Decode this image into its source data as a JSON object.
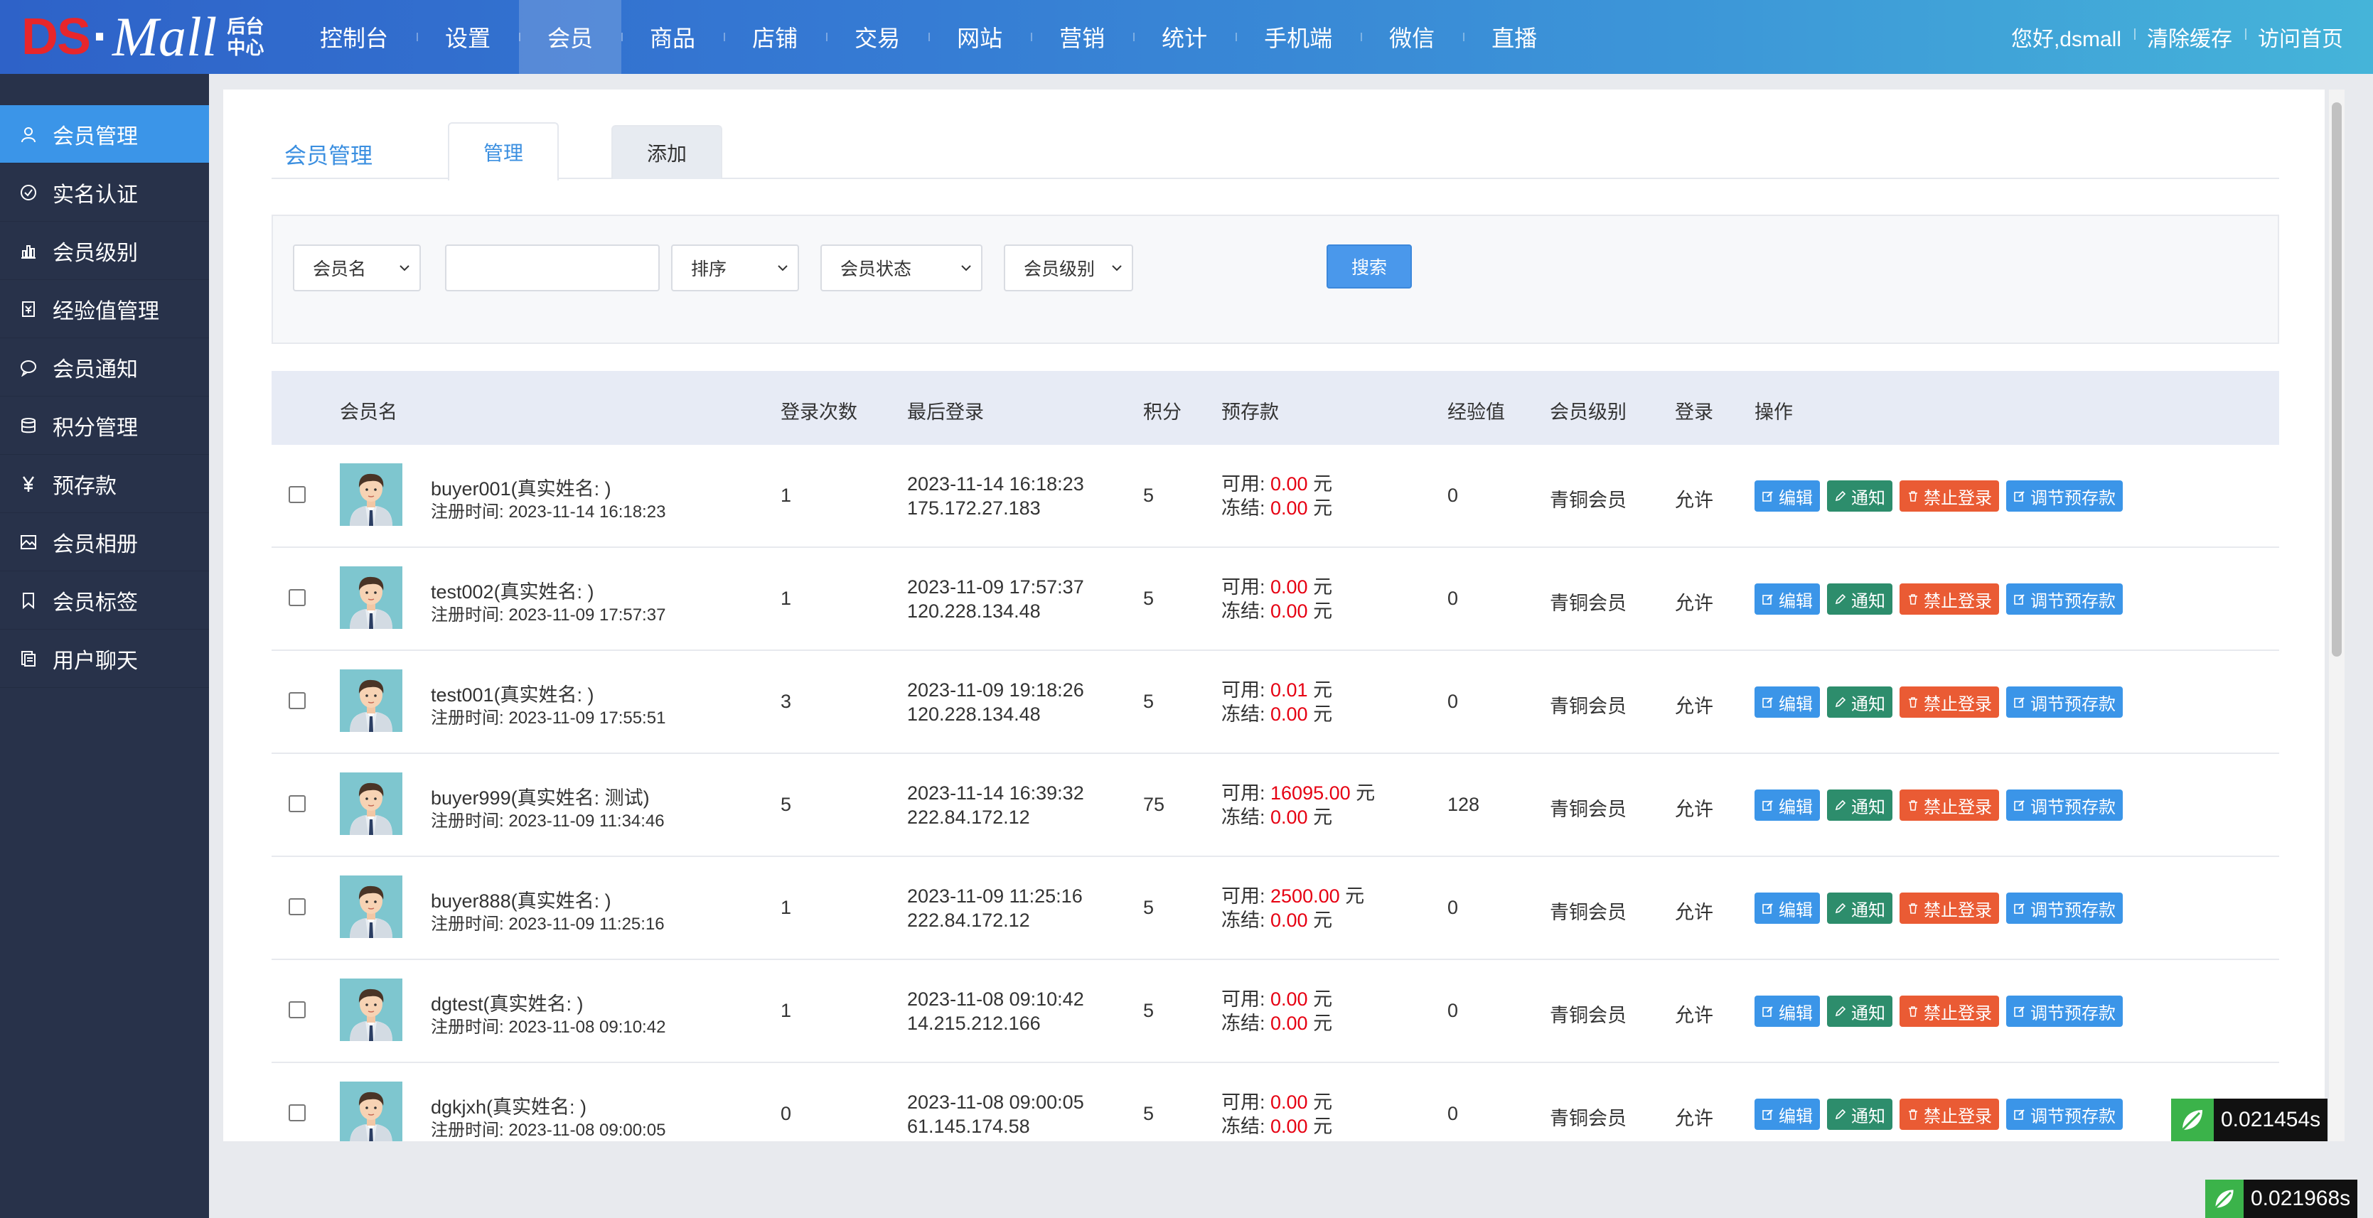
{
  "logo": {
    "ds": "DS",
    "dot": "·",
    "mall": "Mall",
    "sub": "后台中心"
  },
  "nav": [
    "控制台",
    "设置",
    "会员",
    "商品",
    "店铺",
    "交易",
    "网站",
    "营销",
    "统计",
    "手机端",
    "微信",
    "直播"
  ],
  "nav_active": "会员",
  "top_links": {
    "greeting": "您好,dsmall",
    "clear_cache": "清除缓存",
    "visit_home": "访问首页"
  },
  "sidebar": [
    {
      "label": "会员管理",
      "icon": "user-icon"
    },
    {
      "label": "实名认证",
      "icon": "check-circle-icon"
    },
    {
      "label": "会员级别",
      "icon": "bar-chart-icon"
    },
    {
      "label": "经验值管理",
      "icon": "ledger-icon"
    },
    {
      "label": "会员通知",
      "icon": "chat-bubble-icon"
    },
    {
      "label": "积分管理",
      "icon": "database-icon"
    },
    {
      "label": "预存款",
      "icon": "yen-icon"
    },
    {
      "label": "会员相册",
      "icon": "image-icon"
    },
    {
      "label": "会员标签",
      "icon": "bookmark-icon"
    },
    {
      "label": "用户聊天",
      "icon": "copy-icon"
    }
  ],
  "page": {
    "title": "会员管理",
    "tab_manage": "管理",
    "tab_add": "添加"
  },
  "filter": {
    "field_select": "会员名",
    "keyword_value": "",
    "sort_select": "排序",
    "status_select": "会员状态",
    "level_select": "会员级别",
    "search_button": "搜索"
  },
  "table": {
    "headers": {
      "member": "会员名",
      "login_count": "登录次数",
      "last_login": "最后登录",
      "points": "积分",
      "deposit": "预存款",
      "exp": "经验值",
      "level": "会员级别",
      "login": "登录",
      "ops": "操作"
    },
    "labels": {
      "available": "可用: ",
      "frozen": "冻结: ",
      "yuan": " 元",
      "reg_prefix": "注册时间: "
    },
    "op_labels": {
      "edit": "编辑",
      "notify": "通知",
      "ban": "禁止登录",
      "adjust": "调节预存款"
    },
    "rows": [
      {
        "name": "buyer001(真实姓名: )",
        "reg": "2023-11-14 16:18:23",
        "login_count": "1",
        "last_time": "2023-11-14 16:18:23",
        "last_ip": "175.172.27.183",
        "points": "5",
        "available": "0.00",
        "frozen": "0.00",
        "exp": "0",
        "level": "青铜会员",
        "login": "允许"
      },
      {
        "name": "test002(真实姓名: )",
        "reg": "2023-11-09 17:57:37",
        "login_count": "1",
        "last_time": "2023-11-09 17:57:37",
        "last_ip": "120.228.134.48",
        "points": "5",
        "available": "0.00",
        "frozen": "0.00",
        "exp": "0",
        "level": "青铜会员",
        "login": "允许"
      },
      {
        "name": "test001(真实姓名: )",
        "reg": "2023-11-09 17:55:51",
        "login_count": "3",
        "last_time": "2023-11-09 19:18:26",
        "last_ip": "120.228.134.48",
        "points": "5",
        "available": "0.01",
        "frozen": "0.00",
        "exp": "0",
        "level": "青铜会员",
        "login": "允许"
      },
      {
        "name": "buyer999(真实姓名: 测试)",
        "reg": "2023-11-09 11:34:46",
        "login_count": "5",
        "last_time": "2023-11-14 16:39:32",
        "last_ip": "222.84.172.12",
        "points": "75",
        "available": "16095.00",
        "frozen": "0.00",
        "exp": "128",
        "level": "青铜会员",
        "login": "允许"
      },
      {
        "name": "buyer888(真实姓名: )",
        "reg": "2023-11-09 11:25:16",
        "login_count": "1",
        "last_time": "2023-11-09 11:25:16",
        "last_ip": "222.84.172.12",
        "points": "5",
        "available": "2500.00",
        "frozen": "0.00",
        "exp": "0",
        "level": "青铜会员",
        "login": "允许"
      },
      {
        "name": "dgtest(真实姓名: )",
        "reg": "2023-11-08 09:10:42",
        "login_count": "1",
        "last_time": "2023-11-08 09:10:42",
        "last_ip": "14.215.212.166",
        "points": "5",
        "available": "0.00",
        "frozen": "0.00",
        "exp": "0",
        "level": "青铜会员",
        "login": "允许"
      },
      {
        "name": "dgkjxh(真实姓名: )",
        "reg": "2023-11-08 09:00:05",
        "login_count": "0",
        "last_time": "2023-11-08 09:00:05",
        "last_ip": "61.145.174.58",
        "points": "5",
        "available": "0.00",
        "frozen": "0.00",
        "exp": "0",
        "level": "青铜会员",
        "login": "允许"
      }
    ]
  },
  "timers": [
    "0.021454s",
    "0.021968s"
  ],
  "colors": {
    "accent": "#3b95e8",
    "sidebar": "#28324a",
    "notify": "#2d8d6c",
    "ban": "#ea5b34",
    "money": "#e60012"
  }
}
